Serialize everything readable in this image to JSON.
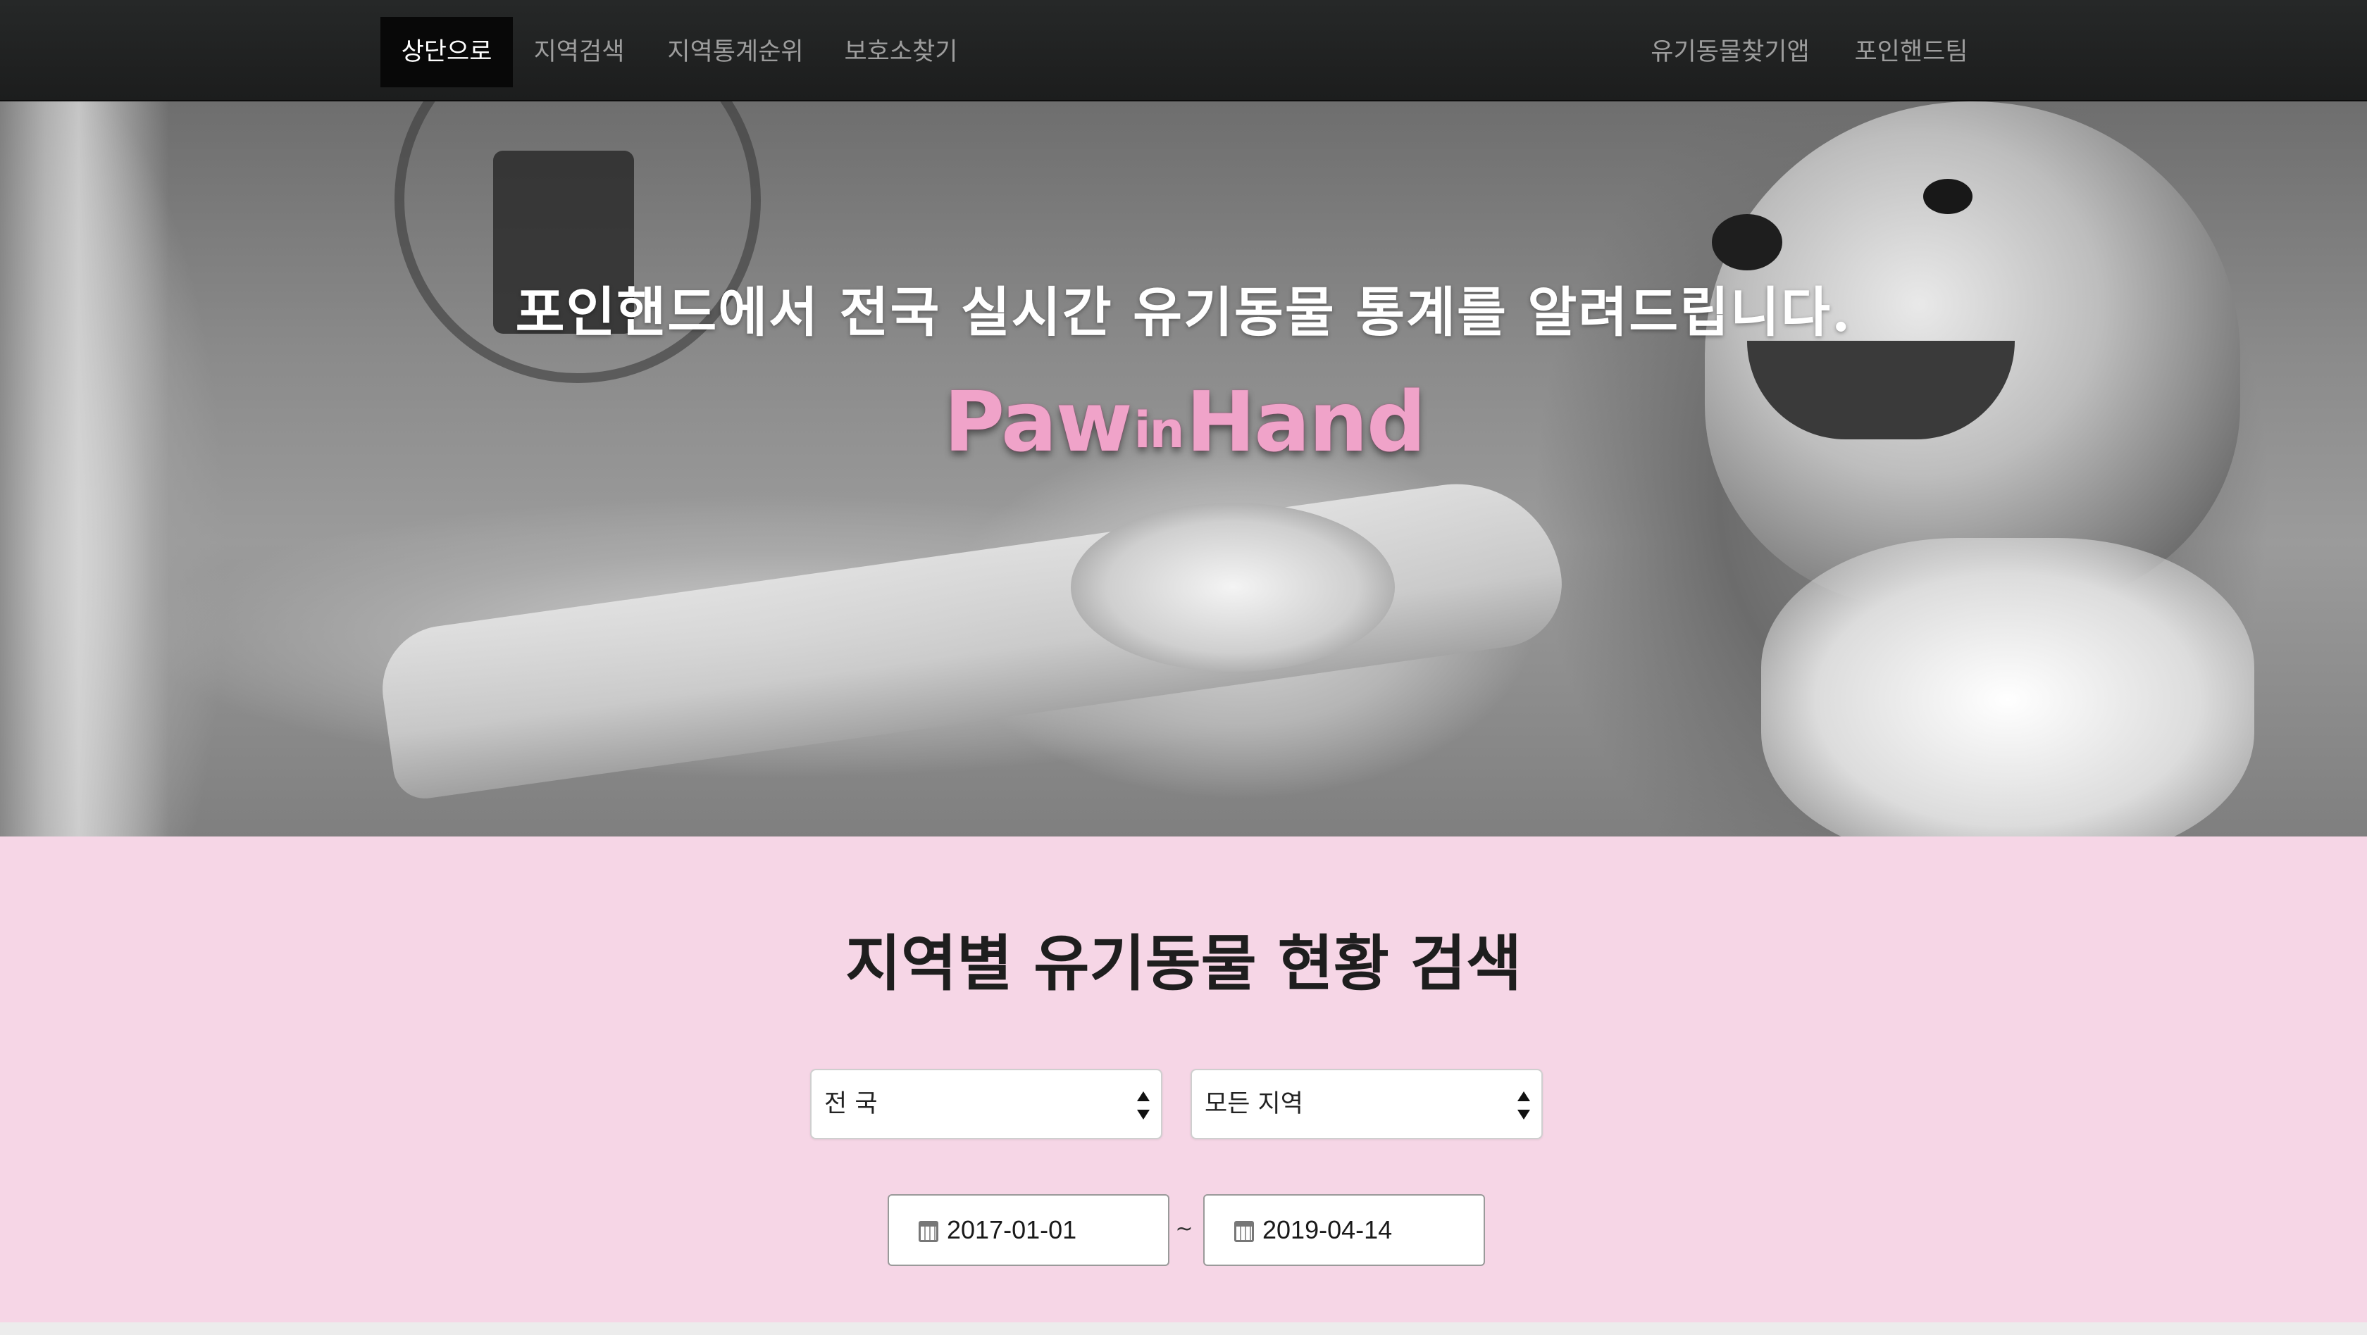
{
  "nav": {
    "left_items": [
      "상단으로",
      "지역검색",
      "지역통계순위",
      "보호소찾기"
    ],
    "right_items": [
      "유기동물찾기앱",
      "포인핸드팀"
    ],
    "active_index": 0
  },
  "hero": {
    "tagline": "포인핸드에서 전국 실시간 유기동물 통계를 알려드립니다.",
    "logo_text": "PawinHand",
    "logo_color": "#f0a3c9"
  },
  "search": {
    "title": "지역별 유기동물 현황 검색",
    "region_select": {
      "value": "전 국"
    },
    "subregion_select": {
      "value": "모든 지역"
    },
    "date_start": "2017-01-01",
    "date_separator": "~",
    "date_end": "2019-04-14",
    "background_color": "#f6d6e6"
  },
  "icons": {
    "date_start_icon": "calendar-icon",
    "date_end_icon": "calendar-icon"
  }
}
